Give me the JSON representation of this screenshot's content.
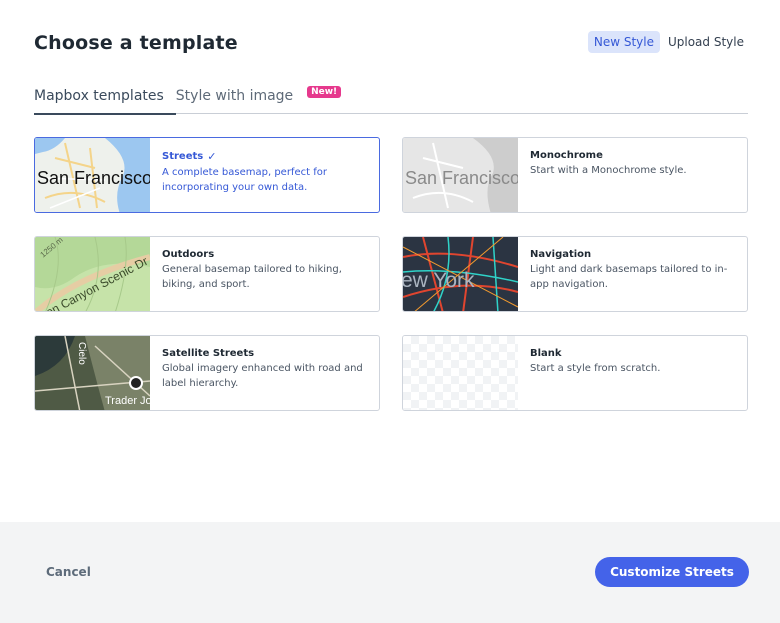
{
  "dialog": {
    "title": "Choose a template"
  },
  "mode_toggle": {
    "new_style": "New Style",
    "upload_style": "Upload Style"
  },
  "tabs": {
    "mapbox_templates": "Mapbox templates",
    "style_with_image": "Style with image",
    "new_badge": "New!"
  },
  "templates": [
    {
      "title": "Streets",
      "description": "A complete basemap, perfect for incorporating your own data.",
      "thumb_label": "San Francisco",
      "selected": true
    },
    {
      "title": "Monochrome",
      "description": "Start with a Monochrome style.",
      "thumb_label": "San Francisco",
      "selected": false
    },
    {
      "title": "Outdoors",
      "description": "General basemap tailored to hiking, biking, and sport.",
      "thumb_label": "non Canyon Scenic Dr",
      "thumb_label_2": "1250 m",
      "selected": false
    },
    {
      "title": "Navigation",
      "description": "Light and dark basemaps tailored to in-app navigation.",
      "thumb_label": "ew York",
      "selected": false
    },
    {
      "title": "Satellite Streets",
      "description": "Global imagery enhanced with road and label hierarchy.",
      "thumb_label": "Trader Jo",
      "thumb_label_2": "Cielo",
      "selected": false
    },
    {
      "title": "Blank",
      "description": "Start a style from scratch.",
      "selected": false
    }
  ],
  "footer": {
    "cancel": "Cancel",
    "customize": "Customize Streets"
  },
  "colors": {
    "accent": "#4463e9",
    "badge": "#e6398d",
    "selected_border": "#4a6ae0"
  }
}
